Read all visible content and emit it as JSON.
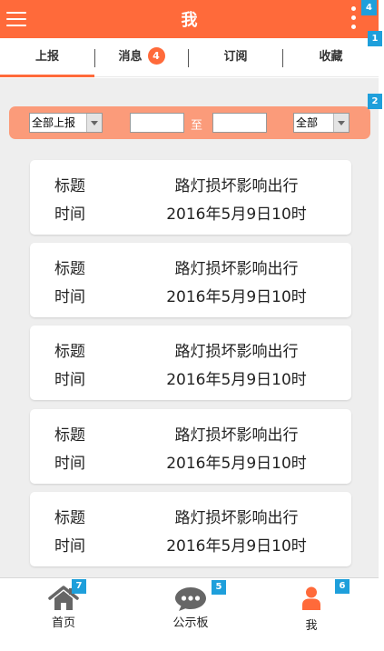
{
  "header": {
    "title": "我",
    "menu_icon": "hamburger-menu-icon",
    "more_icon": "more-vertical-icon",
    "marker": "4"
  },
  "tabs": {
    "marker": "1",
    "items": [
      {
        "label": "上报",
        "active": true
      },
      {
        "label": "消息",
        "count": "4"
      },
      {
        "label": "订阅"
      },
      {
        "label": "收藏"
      }
    ]
  },
  "filter": {
    "marker": "2",
    "type_select": "全部上报",
    "from_date": "",
    "to_label": "至",
    "to_date": "",
    "status_select": "全部"
  },
  "list": {
    "items": [
      {
        "title_key": "标题",
        "title": "路灯损坏影响出行",
        "time_key": "时间",
        "time": "2016年5月9日10时"
      },
      {
        "title_key": "标题",
        "title": "路灯损坏影响出行",
        "time_key": "时间",
        "time": "2016年5月9日10时"
      },
      {
        "title_key": "标题",
        "title": "路灯损坏影响出行",
        "time_key": "时间",
        "time": "2016年5月9日10时"
      },
      {
        "title_key": "标题",
        "title": "路灯损坏影响出行",
        "time_key": "时间",
        "time": "2016年5月9日10时"
      },
      {
        "title_key": "标题",
        "title": "路灯损坏影响出行",
        "time_key": "时间",
        "time": "2016年5月9日10时"
      }
    ]
  },
  "bottom_nav": {
    "items": [
      {
        "label": "首页",
        "icon": "home-icon",
        "marker": "7",
        "active": false
      },
      {
        "label": "公示板",
        "icon": "chat-bubble-icon",
        "marker": "5",
        "active": false
      },
      {
        "label": "我",
        "icon": "user-icon",
        "marker": "6",
        "active": true
      }
    ]
  },
  "colors": {
    "accent": "#ff6a3a",
    "filter_bar": "#fb9b7a",
    "marker": "#1e9fdb",
    "background": "#eeeeee"
  }
}
